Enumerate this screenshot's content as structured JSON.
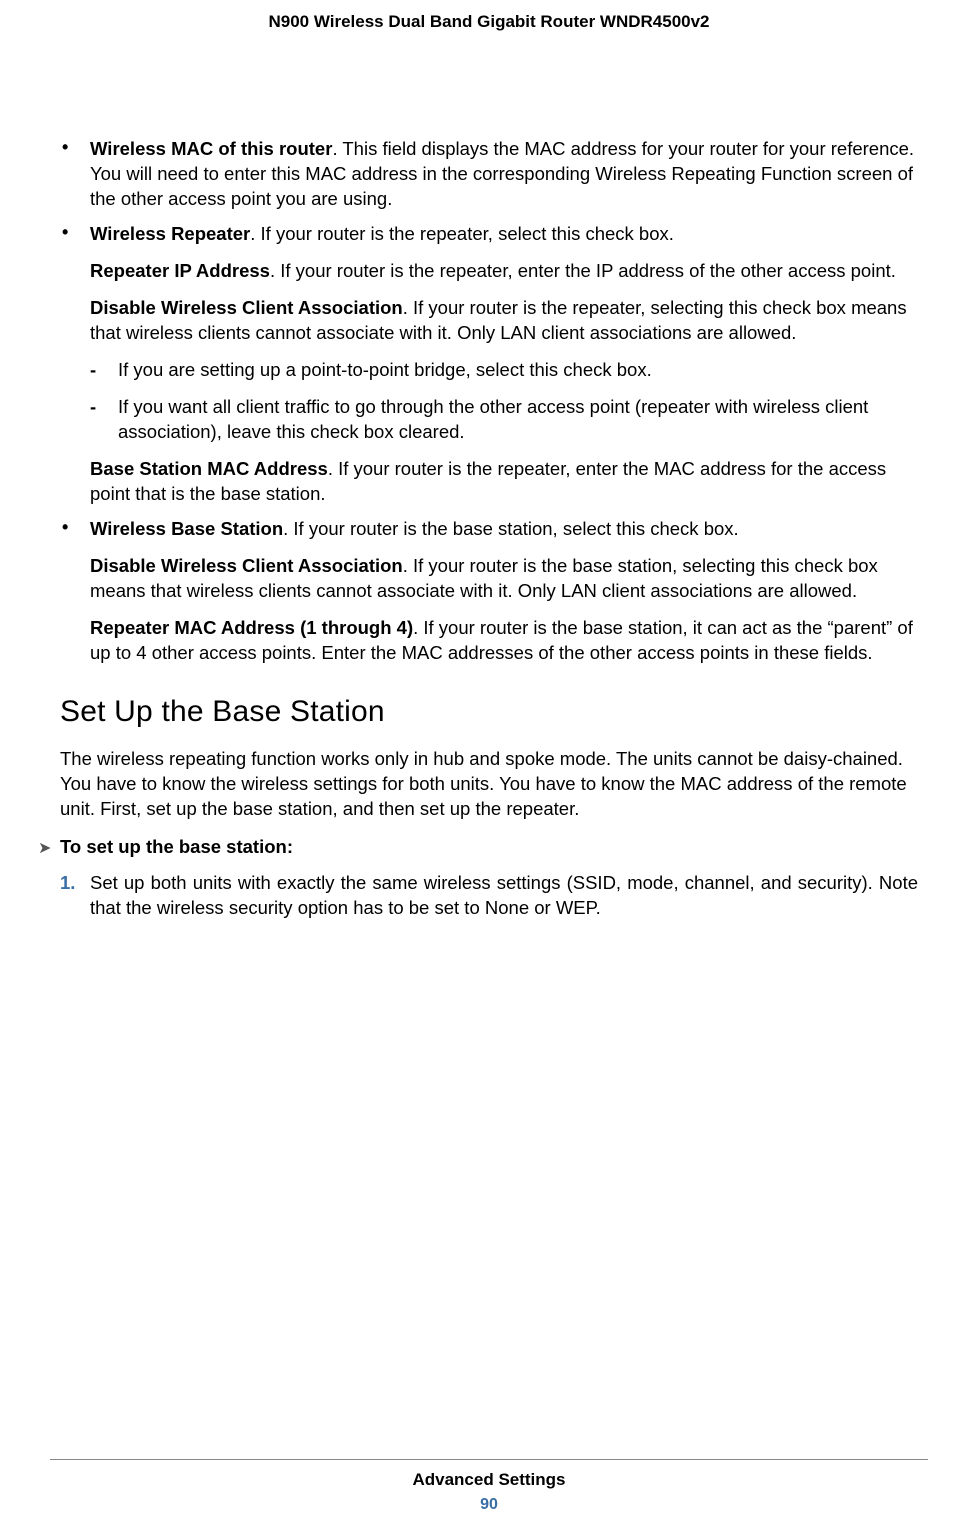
{
  "header": {
    "product_title": "N900 Wireless Dual Band Gigabit Router WNDR4500v2"
  },
  "bullets": [
    {
      "lead": "Wireless MAC of this router",
      "text": ". This field displays the MAC address for your router for your reference. You will need to enter this MAC address in the corresponding Wireless Repeating Function screen of the other access point you are using.",
      "sub_paras": [],
      "dashes": []
    },
    {
      "lead": "Wireless Repeater",
      "text": ". If your router is the repeater, select this check box.",
      "sub_paras_1": [
        {
          "lead": "Repeater IP Address",
          "text": ". If your router is the repeater, enter the IP address of the other access point."
        },
        {
          "lead": "Disable Wireless Client Association",
          "text": ". If your router is the repeater, selecting this check box means that wireless clients cannot associate with it. Only LAN client associations are allowed."
        }
      ],
      "dashes": [
        {
          "text": "If you are setting up a point-to-point bridge, select this check box."
        },
        {
          "text": "If you want all client traffic to go through the other access point (repeater with wireless client association), leave this check box cleared."
        }
      ],
      "sub_paras_2": [
        {
          "lead": "Base Station MAC Address",
          "text": ". If your router is the repeater, enter the MAC address for the access point that is the base station."
        }
      ]
    },
    {
      "lead": "Wireless Base Station",
      "text": ". If your router is the base station, select this check box.",
      "sub_paras_1": [
        {
          "lead": "Disable Wireless Client Association",
          "text": ". If your router is the base station, selecting this check box means that wireless clients cannot associate with it. Only LAN client associations are allowed."
        },
        {
          "lead": "Repeater MAC Address (1 through 4)",
          "text": ". If your router is the base station, it can act as the “parent” of up to 4 other access points. Enter the MAC addresses of the other access points in these fields."
        }
      ],
      "dashes": [],
      "sub_paras_2": []
    }
  ],
  "section": {
    "heading": "Set Up the Base Station",
    "intro": "The wireless repeating function works only in hub and spoke mode. The units cannot be daisy-chained. You have to know the wireless settings for both units. You have to know the MAC address of the remote unit. First, set up the base station, and then set up the repeater.",
    "proc_title": "To set up the base station:",
    "steps": [
      {
        "num": "1.",
        "text": "Set up both units with exactly the same wireless settings (SSID, mode, channel, and security). Note that the wireless security option has to be set to None or WEP."
      }
    ]
  },
  "footer": {
    "section_title": "Advanced Settings",
    "page_number": "90"
  },
  "glyphs": {
    "bullet": "•",
    "dash": "-",
    "arrow": "➤"
  }
}
